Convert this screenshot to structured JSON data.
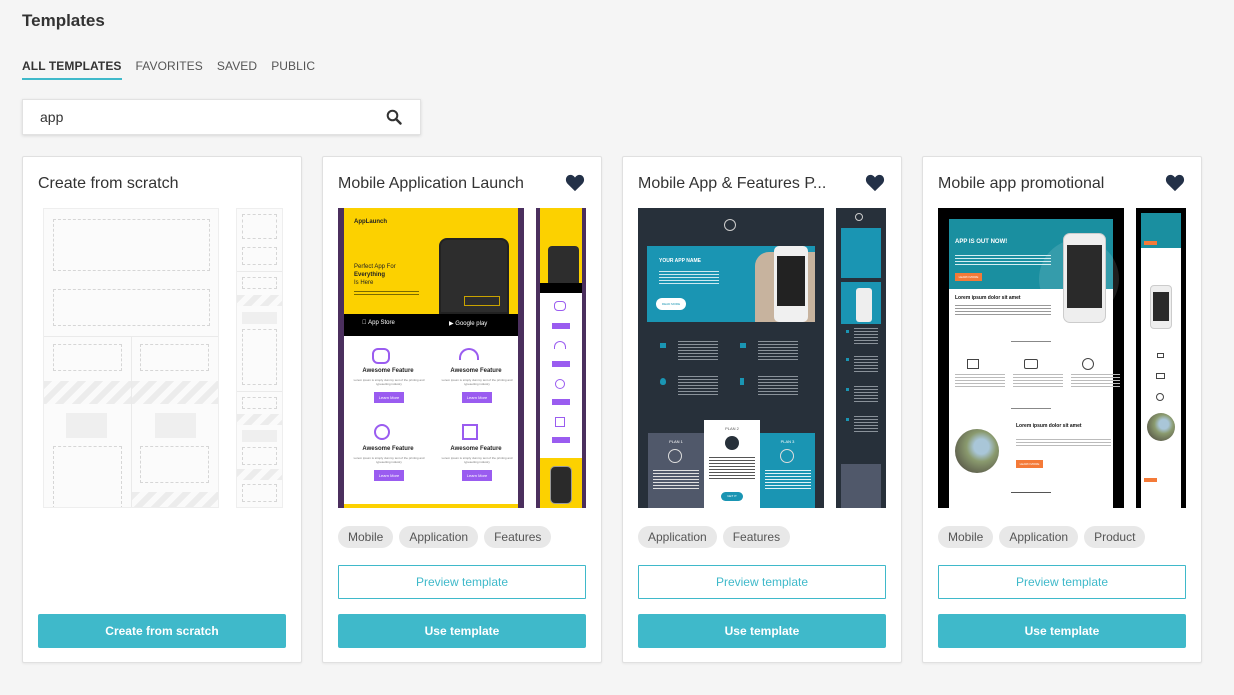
{
  "header": {
    "title": "Templates"
  },
  "tabs": [
    {
      "label": "ALL TEMPLATES",
      "active": true
    },
    {
      "label": "FAVORITES",
      "active": false
    },
    {
      "label": "SAVED",
      "active": false
    },
    {
      "label": "PUBLIC",
      "active": false
    }
  ],
  "search": {
    "value": "app",
    "icon": "search-icon"
  },
  "colors": {
    "accent": "#3fb9ca",
    "heart": "#233148",
    "tag_bg": "#e8e8e8"
  },
  "cards": [
    {
      "title": "Create from scratch",
      "favorite": false,
      "tags": [],
      "button_label": "Create from scratch"
    },
    {
      "title": "Mobile Application Launch",
      "favorite": true,
      "tags": [
        "Mobile",
        "Application",
        "Features"
      ],
      "preview_label": "Preview template",
      "use_label": "Use template",
      "preview": {
        "brand": "AppLaunch",
        "headline": [
          "Perfect App For",
          "Everything",
          "Is Here"
        ],
        "store_buttons": [
          "Download on the App Store",
          "GET IT ON Google play"
        ],
        "feature_title": "Awesome Feature",
        "feature_button": "Learn More"
      }
    },
    {
      "title": "Mobile App & Features P...",
      "favorite": true,
      "tags": [
        "Application",
        "Features"
      ],
      "preview_label": "Preview template",
      "use_label": "Use template",
      "preview": {
        "hero_title": "YOUR APP NAME",
        "hero_button": "READ MORE",
        "plans": [
          "PLAN 1",
          "PLAN 2",
          "PLAN 3"
        ],
        "plan_button": "GET IT"
      }
    },
    {
      "title": "Mobile app promotional",
      "favorite": true,
      "tags": [
        "Mobile",
        "Application",
        "Product"
      ],
      "preview_label": "Preview template",
      "use_label": "Use template",
      "preview": {
        "hero_title": "APP IS OUT NOW!",
        "hero_button": "LEARN MORE",
        "section_title": "Lorem ipsum dolor sit amet"
      }
    }
  ]
}
